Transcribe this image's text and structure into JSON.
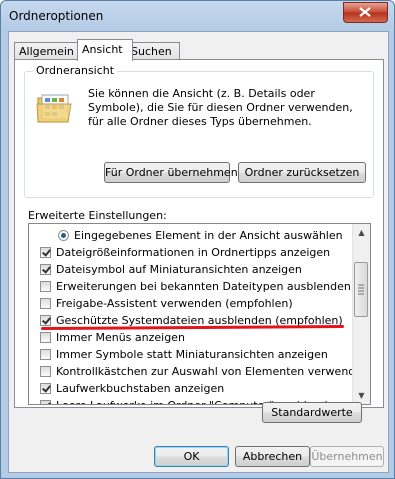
{
  "window": {
    "title": "Ordneroptionen"
  },
  "tabs": [
    {
      "label": "Allgemein",
      "active": false
    },
    {
      "label": "Ansicht",
      "active": true
    },
    {
      "label": "Suchen",
      "active": false
    }
  ],
  "ordneransicht": {
    "legend": "Ordneransicht",
    "description": "Sie können die Ansicht (z. B. Details oder Symbole), die Sie für diesen Ordner verwenden, für alle Ordner dieses Typs übernehmen.",
    "apply_button": "Für Ordner übernehmen",
    "reset_button": "Ordner zurücksetzen"
  },
  "advanced": {
    "label": "Erweiterte Einstellungen:",
    "items": [
      {
        "type": "radio",
        "checked": true,
        "label": "Eingegebenes Element in der Ansicht auswählen"
      },
      {
        "type": "checkbox",
        "checked": true,
        "label": "Dateigrößeinformationen in Ordnertipps anzeigen"
      },
      {
        "type": "checkbox",
        "checked": true,
        "label": "Dateisymbol auf Miniaturansichten anzeigen"
      },
      {
        "type": "checkbox",
        "checked": false,
        "label": "Erweiterungen bei bekannten Dateitypen ausblenden"
      },
      {
        "type": "checkbox",
        "checked": false,
        "label": "Freigabe-Assistent verwenden (empfohlen)"
      },
      {
        "type": "checkbox",
        "checked": true,
        "label": "Geschützte Systemdateien ausblenden (empfohlen)"
      },
      {
        "type": "checkbox",
        "checked": false,
        "label": "Immer Menüs anzeigen"
      },
      {
        "type": "checkbox",
        "checked": false,
        "label": "Immer Symbole statt Miniaturansichten anzeigen"
      },
      {
        "type": "checkbox",
        "checked": false,
        "label": "Kontrollkästchen zur Auswahl von Elementen verwenden"
      },
      {
        "type": "checkbox",
        "checked": true,
        "label": "Laufwerkbuchstaben anzeigen"
      },
      {
        "type": "checkbox",
        "checked": true,
        "label": "Leere Laufwerke im Ordner \"Computer\" ausblenden"
      }
    ]
  },
  "defaults_button": "Standardwerte",
  "footer": {
    "ok": "OK",
    "cancel": "Abbrechen",
    "apply": "Übernehmen"
  },
  "colors": {
    "annotation_line": "#e3141c",
    "close_button": "#c44a33"
  }
}
